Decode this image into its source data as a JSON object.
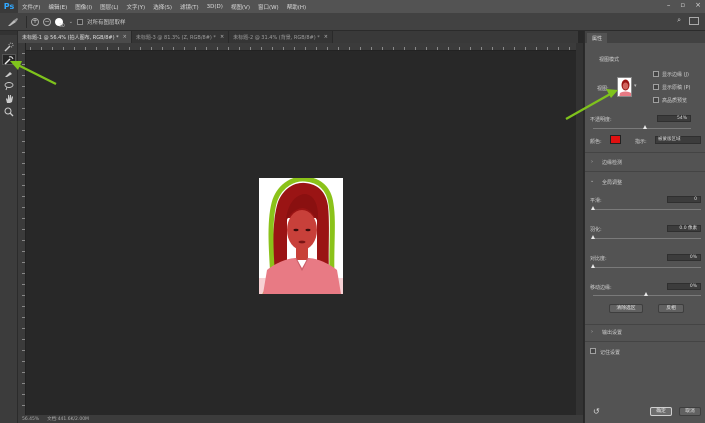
{
  "app": {
    "logo": "Ps",
    "menus": [
      "文件(F)",
      "编辑(E)",
      "图像(I)",
      "图层(L)",
      "文字(Y)",
      "选择(S)",
      "滤镜(T)",
      "3D(D)",
      "视图(V)",
      "窗口(W)",
      "帮助(H)"
    ]
  },
  "options": {
    "brush_size": "30",
    "sample_all_label": "对所有图层取样"
  },
  "tabs": [
    {
      "label": "未标题-1 @ 56.4% (拍人图布, RGB/8#) *",
      "close": "×"
    },
    {
      "label": "未标题-3 @ 81.3% (Z, RGB/8#) *",
      "close": "×"
    },
    {
      "label": "未标题-2 @ 31.4% (背景, RGB/8#) *",
      "close": "×"
    }
  ],
  "status": {
    "zoom": "56.45%",
    "doc": "文档:441.6K/2.00M"
  },
  "panel": {
    "tab": "属性",
    "view_mode_title": "视图模式",
    "view_label": "视图:",
    "show_edge": "显示边缘 (J)",
    "show_original": "显示原稿 (P)",
    "hq_preview": "高品质预览",
    "opacity_label": "不透明度:",
    "opacity_value": "54%",
    "opacity_fraction": 0.54,
    "color_label": "颜色:",
    "color_value": "#e01010",
    "indicate_label": "指示:",
    "indicate_value": "被蒙版区域",
    "edge_detection": "边缘检测",
    "global_adjust": "全局调整",
    "smooth_label": "平滑:",
    "smooth_value": "0",
    "feather_label": "羽化:",
    "feather_value": "0.0 像素",
    "contrast_label": "对比度:",
    "contrast_value": "0%",
    "shift_edge_label": "移动边缘:",
    "shift_edge_value": "0%",
    "clear_selection": "清除选区",
    "invert": "反相",
    "output_settings": "输出设置",
    "remember_settings": "记住设置",
    "ok": "确定",
    "cancel": "取消"
  },
  "colors": {
    "accent": "#31a8ff",
    "annotation_arrow": "#7fc31c",
    "mask_red": "#e01010",
    "edge_green": "#8bc21a"
  }
}
